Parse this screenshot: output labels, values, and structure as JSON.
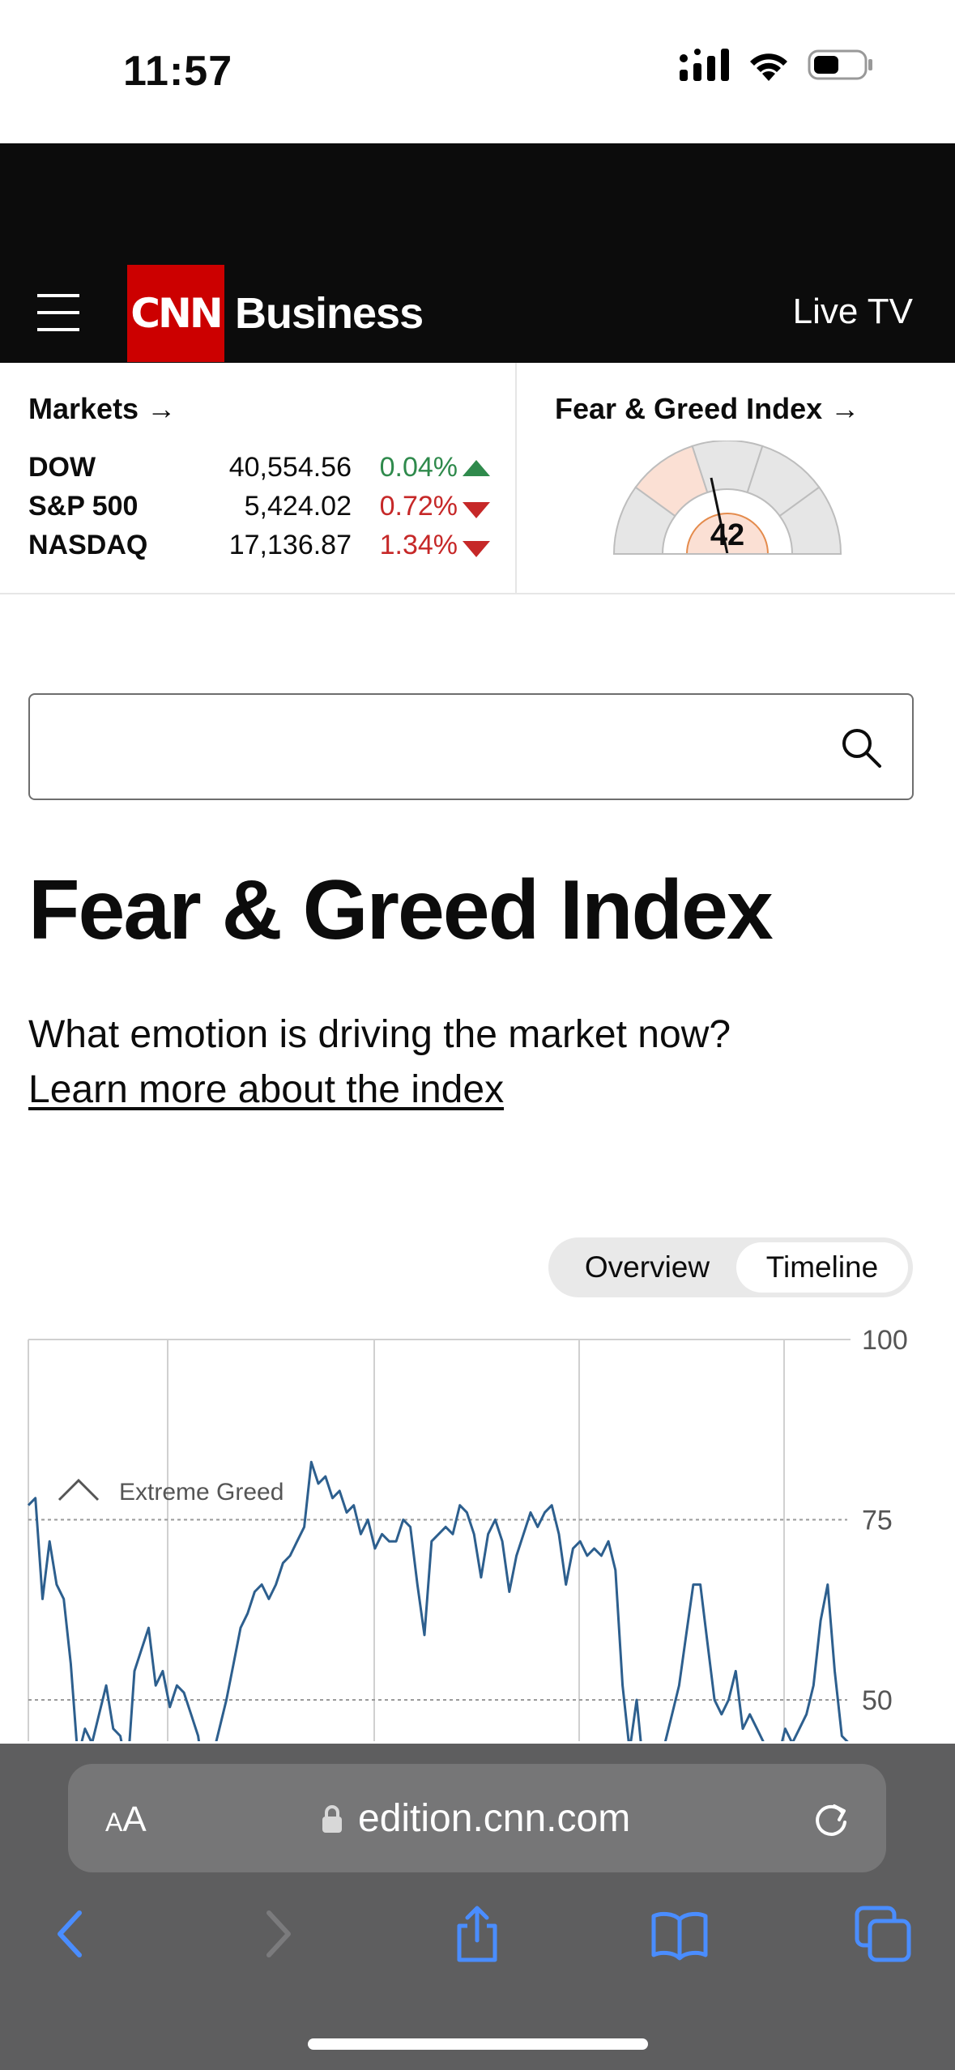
{
  "status_bar": {
    "time": "11:57"
  },
  "header": {
    "logo": "CNN",
    "section": "Business",
    "live_tv": "Live TV"
  },
  "markets": {
    "title": "Markets →",
    "rows": [
      {
        "name": "DOW",
        "value": "40,554.56",
        "change": "0.04%",
        "direction": "up",
        "color": "#2f8a4c"
      },
      {
        "name": "S&P 500",
        "value": "5,424.02",
        "change": "0.72%",
        "direction": "down",
        "color": "#c62828"
      },
      {
        "name": "NASDAQ",
        "value": "17,136.87",
        "change": "1.34%",
        "direction": "down",
        "color": "#c62828"
      }
    ]
  },
  "fear_greed_widget": {
    "title": "Fear & Greed Index →",
    "value": "42"
  },
  "search": {
    "placeholder": ""
  },
  "page": {
    "title": "Fear & Greed Index",
    "subtitle": "What emotion is driving the market now?",
    "learn_more": "Learn more about the index"
  },
  "toggle": {
    "overview": "Overview",
    "timeline": "Timeline",
    "selected": "Timeline"
  },
  "chart_data": {
    "type": "line",
    "ylim": [
      0,
      100
    ],
    "y_ticks": [
      "100",
      "75",
      "50"
    ],
    "zone_label": "Extreme Greed",
    "line_color": "#2d5f8e",
    "series": [
      {
        "values": [
          77,
          78,
          64,
          72,
          66,
          64,
          55,
          42,
          46,
          44,
          48,
          52,
          46,
          45,
          40,
          54,
          57,
          60,
          52,
          54,
          49,
          52,
          51,
          48,
          45,
          38,
          42,
          46,
          50,
          55,
          60,
          62,
          65,
          66,
          64,
          66,
          69,
          70,
          72,
          74,
          83,
          80,
          81,
          78,
          79,
          76,
          77,
          73,
          75,
          71,
          73,
          72,
          72,
          75,
          74,
          66,
          59,
          72,
          73,
          74,
          73,
          77,
          76,
          73,
          67,
          73,
          75,
          72,
          65,
          70,
          73,
          76,
          74,
          76,
          77,
          73,
          66,
          71,
          72,
          70,
          71,
          70,
          72,
          68,
          52,
          43,
          50,
          40,
          38,
          42,
          44,
          48,
          52,
          59,
          66,
          66,
          58,
          50,
          48,
          50,
          54,
          46,
          48,
          46,
          44,
          40,
          42,
          46,
          44,
          46,
          48,
          52,
          61,
          66,
          54,
          45,
          44
        ]
      }
    ]
  },
  "safari": {
    "aa_small": "A",
    "aa_large": "A",
    "url": "edition.cnn.com"
  }
}
